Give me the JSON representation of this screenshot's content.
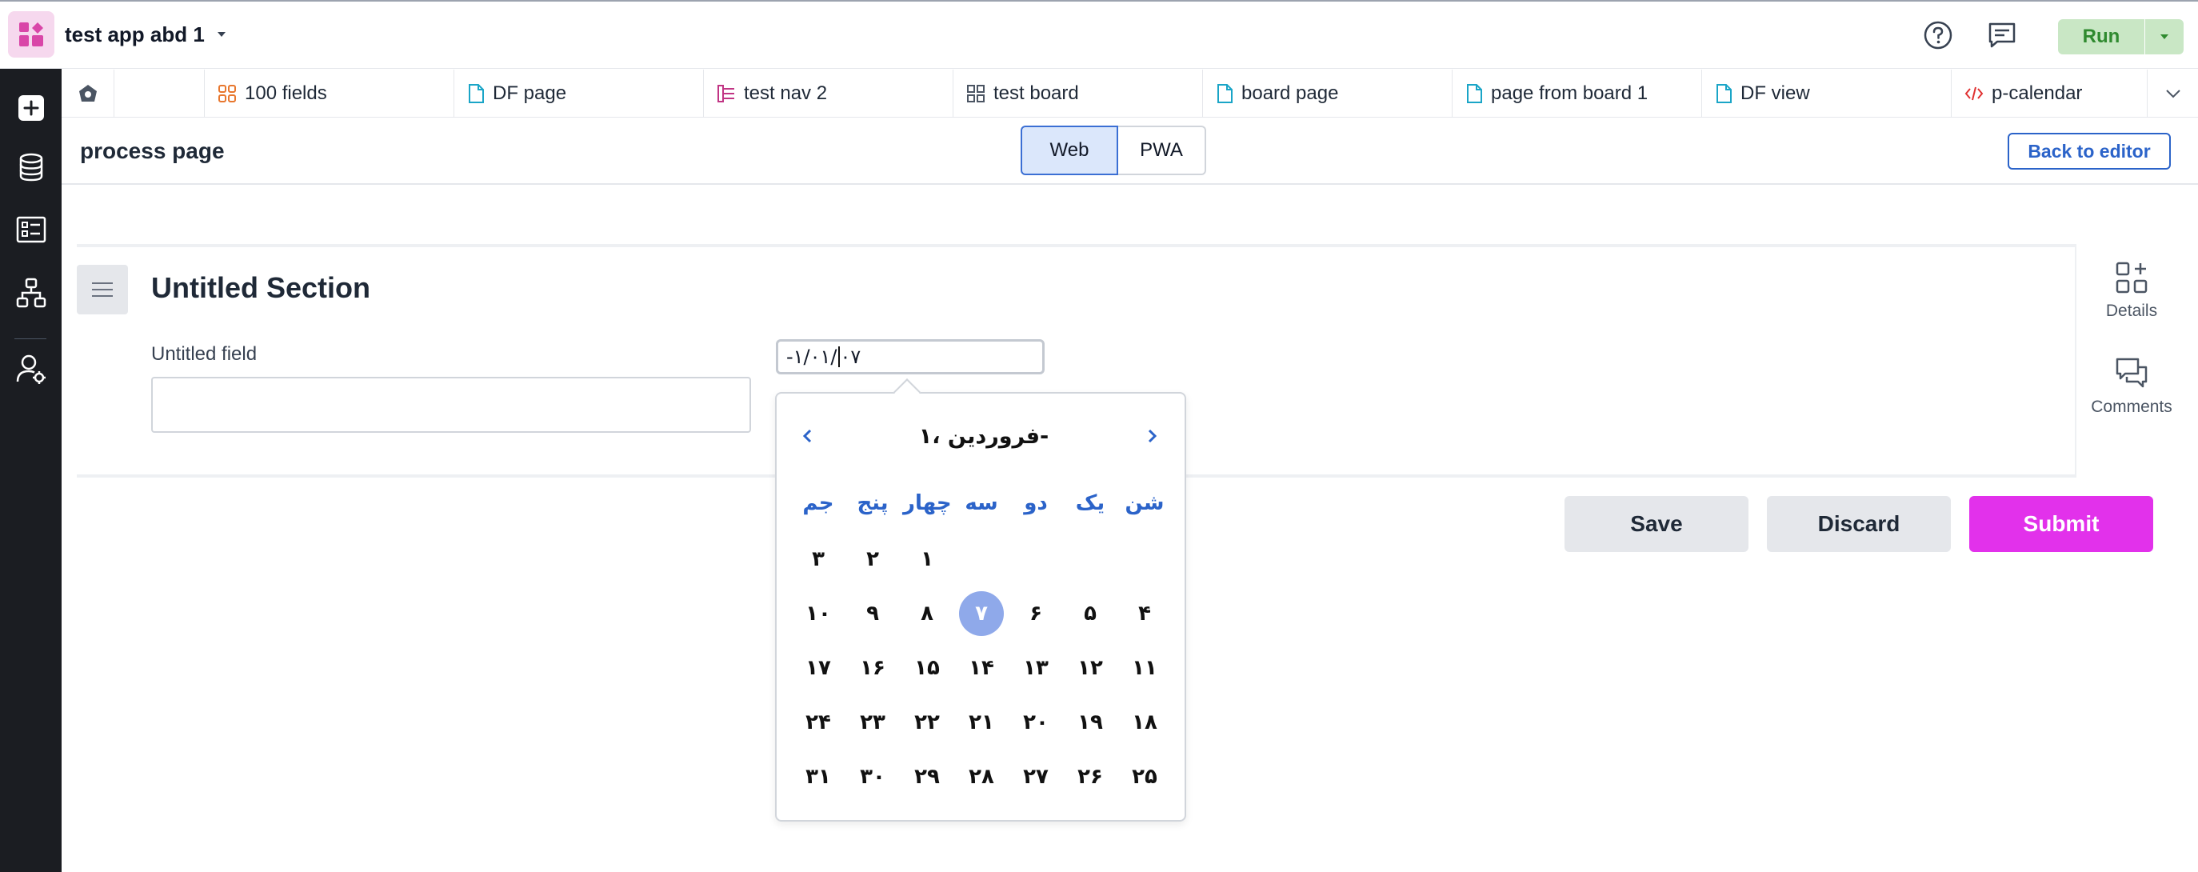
{
  "app": {
    "name": "test app abd 1",
    "logo_color": "#f6d8ee",
    "accent": "#d946a8"
  },
  "topbar": {
    "help_icon": "help-icon",
    "comments_icon": "comments-icon",
    "run_label": "Run"
  },
  "sidebar": {
    "items": [
      {
        "icon": "plus-icon"
      },
      {
        "icon": "database-icon"
      },
      {
        "icon": "form-icon"
      },
      {
        "icon": "workflow-icon"
      },
      {
        "icon": "user-settings-icon"
      }
    ]
  },
  "tabs": [
    {
      "label": "100 fields",
      "icon": "fields-icon",
      "color": "#e8772e"
    },
    {
      "label": "DF page",
      "icon": "page-icon",
      "color": "#1aa5c7"
    },
    {
      "label": "test nav 2",
      "icon": "nav-icon",
      "color": "#c13584"
    },
    {
      "label": "test board",
      "icon": "board-icon",
      "color": "#4b5563"
    },
    {
      "label": "board page",
      "icon": "page-icon",
      "color": "#1aa5c7"
    },
    {
      "label": "page from board 1",
      "icon": "page-icon",
      "color": "#1aa5c7"
    },
    {
      "label": "DF view",
      "icon": "page-icon",
      "color": "#1aa5c7"
    },
    {
      "label": "p-calendar",
      "icon": "code-icon",
      "color": "#e03131"
    }
  ],
  "page": {
    "title": "process page",
    "mode_web": "Web",
    "mode_pwa": "PWA",
    "back_label": "Back to editor"
  },
  "section": {
    "title": "Untitled Section",
    "field_label": "Untitled field",
    "field_value": "",
    "date_before_caret": "-۱/۰۱/",
    "date_after_caret": "۰۷"
  },
  "right_panel": {
    "details_label": "Details",
    "comments_label": "Comments"
  },
  "actions": {
    "save": "Save",
    "discard": "Discard",
    "submit": "Submit",
    "submit_color": "#e231eb"
  },
  "calendar": {
    "title": "فروردین ،۱-",
    "weekdays": [
      "شن",
      "یک",
      "دو",
      "سه",
      "چهار",
      "پنج",
      "جم"
    ],
    "weeks": [
      [
        "",
        "",
        "",
        "",
        "۱",
        "۲",
        "۳"
      ],
      [
        "۴",
        "۵",
        "۶",
        "۷",
        "۸",
        "۹",
        "۱۰"
      ],
      [
        "۱۱",
        "۱۲",
        "۱۳",
        "۱۴",
        "۱۵",
        "۱۶",
        "۱۷"
      ],
      [
        "۱۸",
        "۱۹",
        "۲۰",
        "۲۱",
        "۲۲",
        "۲۳",
        "۲۴"
      ],
      [
        "۲۵",
        "۲۶",
        "۲۷",
        "۲۸",
        "۲۹",
        "۳۰",
        "۳۱"
      ]
    ],
    "selected": "۷",
    "selected_color": "#8fa9ea"
  }
}
